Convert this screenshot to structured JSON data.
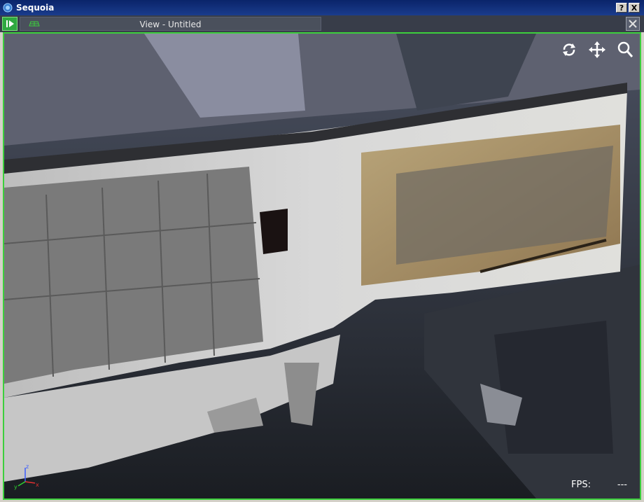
{
  "app": {
    "title": "Sequoia"
  },
  "window_buttons": {
    "help": "?",
    "close": "X"
  },
  "tab": {
    "label": "View - Untitled"
  },
  "viewport": {
    "fps_label": "FPS:",
    "fps_value": "---",
    "tools": [
      "rotate-icon",
      "pan-icon",
      "zoom-icon"
    ],
    "axes": {
      "x": "x",
      "y": "y",
      "z": "z"
    }
  },
  "colors": {
    "accent": "#3ccf3c",
    "titlebar": "#0a246a",
    "tabbar": "#383d49"
  }
}
